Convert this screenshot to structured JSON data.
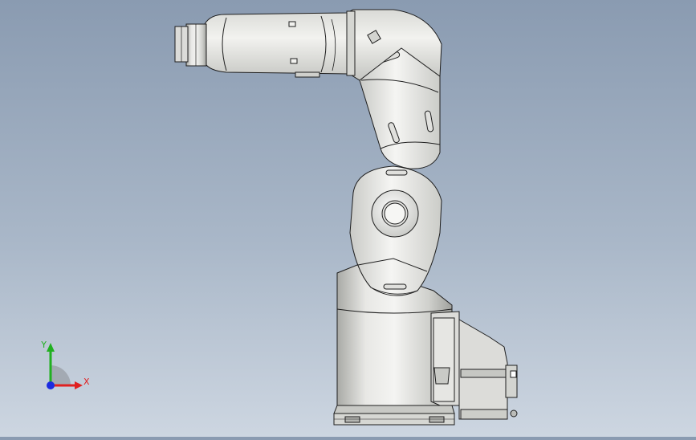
{
  "viewport": {
    "model": "six-axis-robot-arm-side-view",
    "background_top": "#8a9bb1",
    "background_bottom": "#cdd6e1",
    "body_color": "#e4e4e1",
    "shade_color": "#b9bab6",
    "edge_color": "#1e1e1e"
  },
  "triad": {
    "x_label": "X",
    "y_label": "Y",
    "x_color": "#e02020",
    "y_color": "#20b020",
    "z_color": "#1b2be0"
  }
}
